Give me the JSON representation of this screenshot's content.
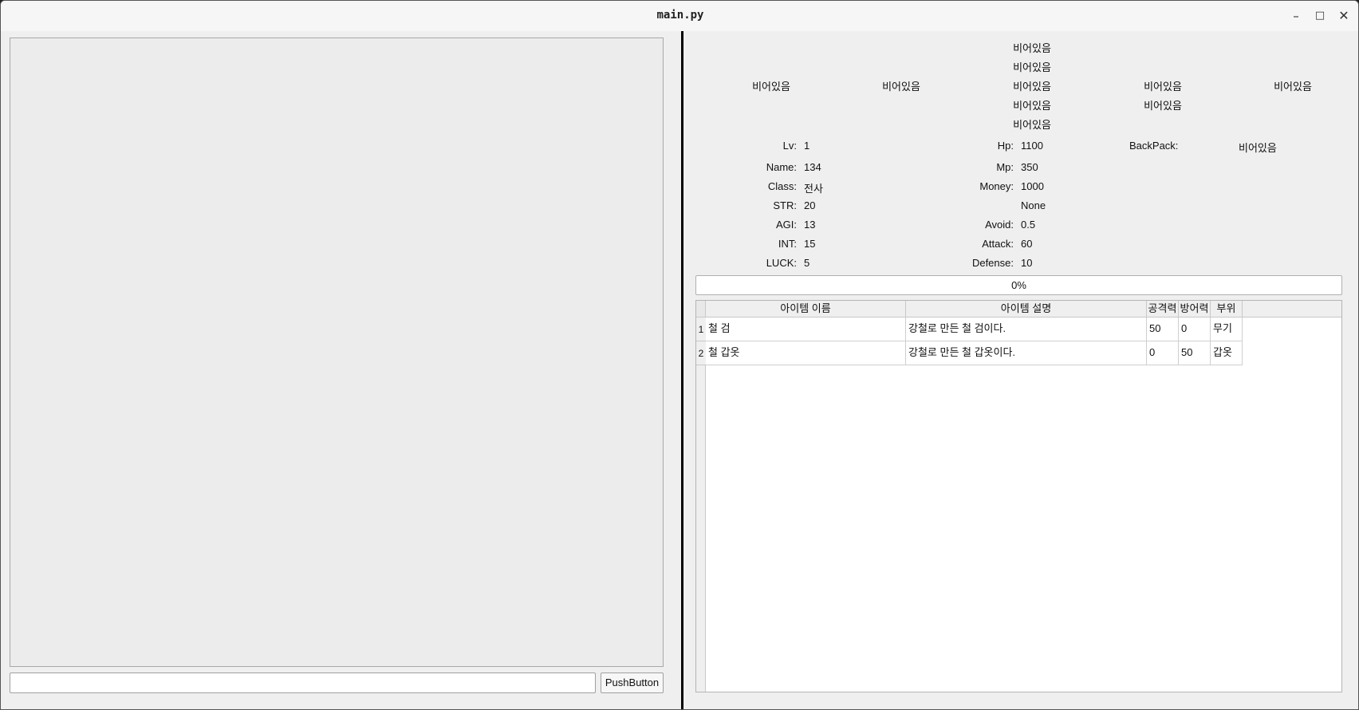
{
  "window": {
    "title": "main.py"
  },
  "left": {
    "input_value": "",
    "button_label": "PushButton"
  },
  "equip": {
    "c1": "비어있음",
    "c2": "비어있음",
    "c3": [
      "비어있음",
      "비어있음",
      "비어있음",
      "비어있음",
      "비어있음"
    ],
    "c4": [
      "비어있음",
      "비어있음"
    ],
    "c5": "비어있음"
  },
  "stats": {
    "lv_label": "Lv:",
    "lv": "1",
    "name_label": "Name:",
    "name": "134",
    "class_label": "Class:",
    "class": "전사",
    "str_label": "STR:",
    "str": "20",
    "agi_label": "AGI:",
    "agi": "13",
    "int_label": "INT:",
    "int": "15",
    "luck_label": "LUCK:",
    "luck": "5",
    "hp_label": "Hp:",
    "hp": "1100",
    "mp_label": "Mp:",
    "mp": "350",
    "money_label": "Money:",
    "money": "1000",
    "extra": "None",
    "avoid_label": "Avoid:",
    "avoid": "0.5",
    "attack_label": "Attack:",
    "attack": "60",
    "defense_label": "Defense:",
    "defense": "10",
    "backpack_label": "BackPack:",
    "backpack": "비어있음"
  },
  "progress": {
    "text": "0%",
    "value": 0
  },
  "items_table": {
    "columns": [
      "아이템 이름",
      "아이템 설명",
      "공격력",
      "방어력",
      "부위"
    ],
    "rows": [
      {
        "index": "1",
        "cells": [
          "철 검",
          "강철로 만든 철 검이다.",
          "50",
          "0",
          "무기"
        ]
      },
      {
        "index": "2",
        "cells": [
          "철 갑옷",
          "강철로 만든 철 갑옷이다.",
          "0",
          "50",
          "갑옷"
        ]
      }
    ]
  }
}
